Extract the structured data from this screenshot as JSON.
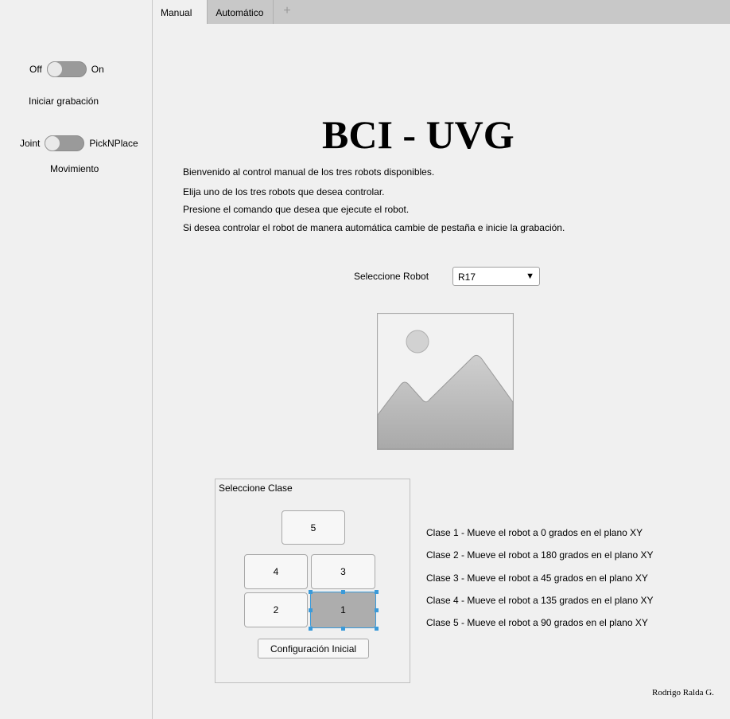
{
  "left_panel": {
    "recording_toggle": {
      "off_label": "Off",
      "on_label": "On",
      "state": "off"
    },
    "recording_label": "Iniciar grabación",
    "mode_toggle": {
      "off_label": "Joint",
      "on_label": "PickNPlace",
      "state": "off"
    },
    "mode_label": "Movimiento"
  },
  "tabs": [
    {
      "label": "Manual",
      "active": true
    },
    {
      "label": "Automático",
      "active": false
    },
    {
      "label": "+",
      "active": false
    }
  ],
  "main": {
    "title": "BCI - UVG",
    "intro_lines": [
      "Bienvenido al control manual de los tres robots disponibles.",
      "Elija uno de los tres robots que desea controlar.",
      "Presione el comando que desea que ejecute el robot.",
      "Si desea controlar el robot de manera automática cambie de pestaña e inicie la grabación."
    ],
    "robot_select": {
      "label": "Seleccione Robot",
      "value": "R17"
    },
    "image_icon": "image-placeholder-icon",
    "class_panel": {
      "title": "Seleccione Clase",
      "buttons": [
        {
          "label": "5",
          "selected": false
        },
        {
          "label": "4",
          "selected": false
        },
        {
          "label": "3",
          "selected": false
        },
        {
          "label": "2",
          "selected": false
        },
        {
          "label": "1",
          "selected": true
        }
      ],
      "reset_button": "Configuración Inicial"
    },
    "class_descriptions": [
      "Clase 1 - Mueve el robot a 0 grados en el plano XY",
      "Clase 2 - Mueve el robot a 180 grados en el plano XY",
      "Clase 3 - Mueve el robot a 45 grados en el plano XY",
      "Clase 4 - Mueve el robot a 135 grados en el plano XY",
      "Clase 5 - Mueve el robot a 90 grados en el plano XY"
    ],
    "author": "Rodrigo Ralda G."
  },
  "colors": {
    "background": "#f0f0f0",
    "tab_bar": "#c8c8c8",
    "selected_button": "#adadad",
    "selection_handles": "#3a9ad9",
    "switch_track": "#9a9a9a"
  }
}
